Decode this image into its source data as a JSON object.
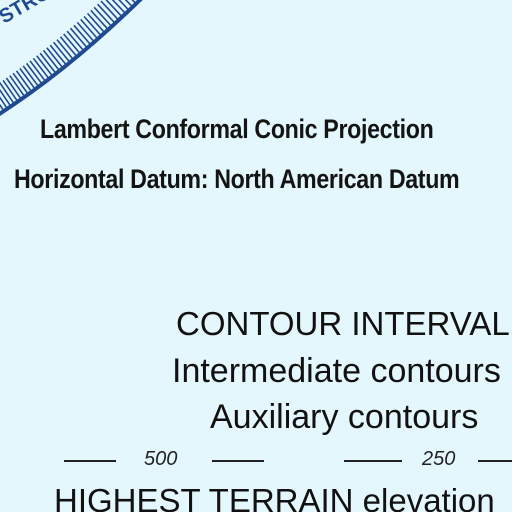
{
  "boundary": {
    "label": "STRO",
    "color": "#1f4a8f"
  },
  "projection": {
    "line1": "Lambert Conformal Conic Projection",
    "line2": "Horizontal Datum: North American Datum"
  },
  "contour": {
    "title": "CONTOUR INTERVAL",
    "intermediate": "Intermediate contours",
    "auxiliary": "Auxiliary contours"
  },
  "scale_marks": [
    "500",
    "250"
  ],
  "terrain": {
    "label": "HIGHEST TERRAIN",
    "suffix": " elevation"
  },
  "colors": {
    "background": "#e4f7fd",
    "ink": "#141414",
    "boundary": "#1f4a8f"
  }
}
